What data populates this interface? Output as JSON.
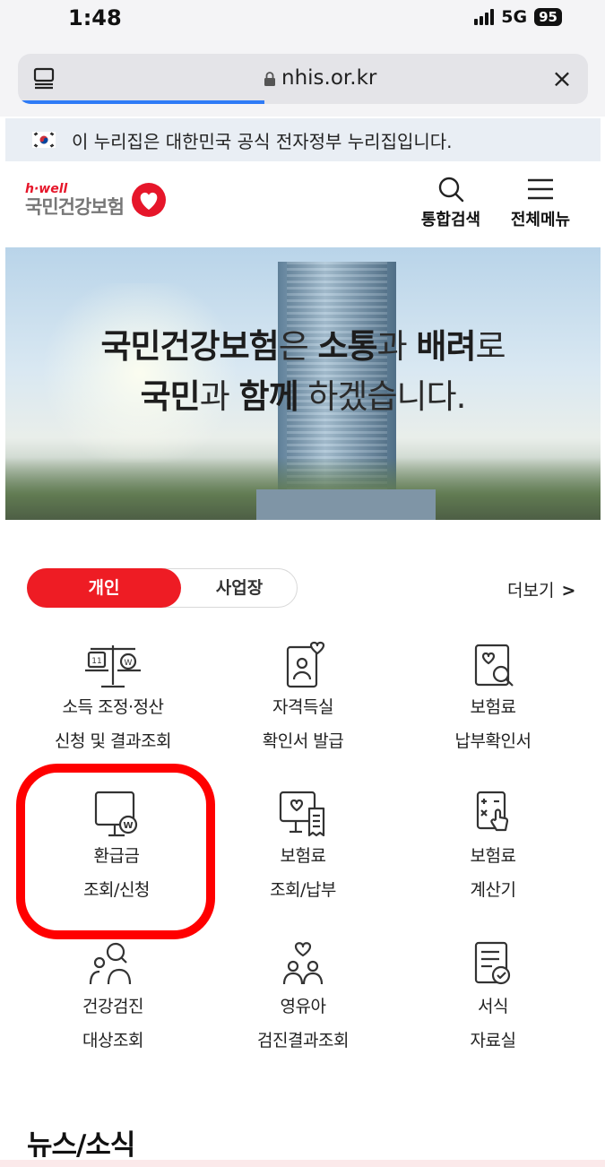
{
  "status_bar": {
    "time": "1:48",
    "network": "5G",
    "battery": "95"
  },
  "browser": {
    "domain": "nhis.or.kr",
    "close_label": "×"
  },
  "gov_banner": {
    "text": "이 누리집은 대한민국 공식 전자정부 누리집입니다."
  },
  "header": {
    "logo_top": "h·well",
    "logo_name": "국민건강보험",
    "search_label": "통합검색",
    "menu_label": "전체메뉴"
  },
  "hero": {
    "line1_a": "국민건강보험",
    "line1_b": "은 ",
    "line1_c": "소통",
    "line1_d": "과 ",
    "line1_e": "배려",
    "line1_f": "로",
    "line2_a": "국민",
    "line2_b": "과 ",
    "line2_c": "함께",
    "line2_d": " 하겠습니다."
  },
  "tabs": {
    "personal": "개인",
    "business": "사업장",
    "more": "더보기"
  },
  "services": [
    {
      "line1": "소득 조정·정산",
      "line2": "신청 및 결과조회",
      "icon": "scale-icon"
    },
    {
      "line1": "자격득실",
      "line2": "확인서 발급",
      "icon": "id-card-heart-icon"
    },
    {
      "line1": "보험료",
      "line2": "납부확인서",
      "icon": "payment-search-icon"
    },
    {
      "line1": "환급금",
      "line2": "조회/신청",
      "icon": "refund-monitor-icon"
    },
    {
      "line1": "보험료",
      "line2": "조회/납부",
      "icon": "monitor-receipt-icon"
    },
    {
      "line1": "보험료",
      "line2": "계산기",
      "icon": "calculator-icon"
    },
    {
      "line1": "건강검진",
      "line2": "대상조회",
      "icon": "people-search-icon"
    },
    {
      "line1": "영유아",
      "line2": "검진결과조회",
      "icon": "family-heart-icon"
    },
    {
      "line1": "서식",
      "line2": "자료실",
      "icon": "document-check-icon"
    }
  ],
  "news": {
    "title": "뉴스/소식"
  },
  "colors": {
    "accent": "#ee1c24",
    "highlight": "#ff0000",
    "progress": "#2f7bf6"
  }
}
